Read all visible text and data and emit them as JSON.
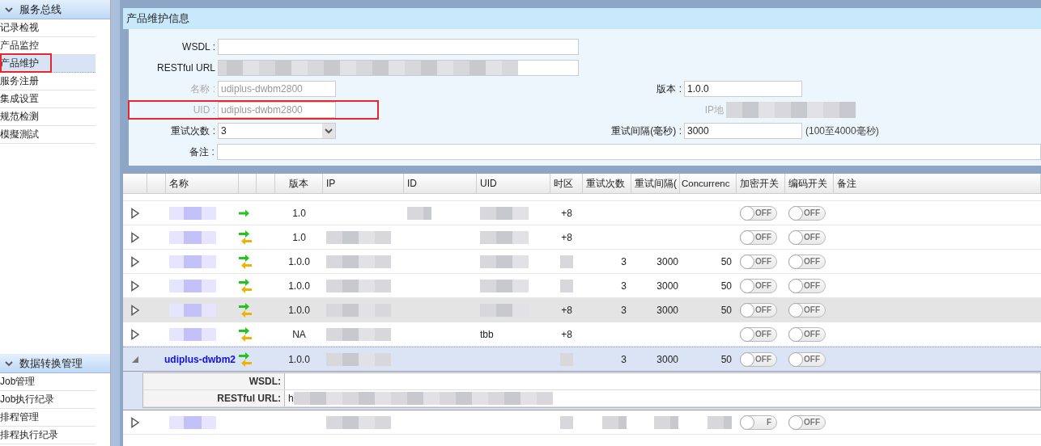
{
  "sidebar": {
    "sections": [
      {
        "title": "服务总线",
        "expanded": true,
        "items": [
          {
            "label": "记录检视",
            "selected": false,
            "marked": false
          },
          {
            "label": "产品监控",
            "selected": false,
            "marked": false
          },
          {
            "label": "产品维护",
            "selected": true,
            "marked": true
          },
          {
            "label": "服务注册",
            "selected": false,
            "marked": false
          },
          {
            "label": "集成设置",
            "selected": false,
            "marked": false
          },
          {
            "label": "规范检测",
            "selected": false,
            "marked": false
          },
          {
            "label": "模擬測試",
            "selected": false,
            "marked": false
          }
        ]
      },
      {
        "title": "数据转换管理",
        "expanded": true,
        "items": [
          {
            "label": "Job管理",
            "selected": false,
            "marked": false
          },
          {
            "label": "Job执行纪录",
            "selected": false,
            "marked": false
          },
          {
            "label": "排程管理",
            "selected": false,
            "marked": false
          },
          {
            "label": "排程执行纪录",
            "selected": false,
            "marked": false
          }
        ]
      }
    ]
  },
  "panel": {
    "title": "产品维护信息"
  },
  "form": {
    "wsdl": {
      "label": "WSDL :"
    },
    "url": {
      "label": "RESTful URL"
    },
    "name": {
      "label": "名称 :",
      "value": "udiplus-dwbm2800",
      "disabled": true,
      "marked": false
    },
    "uid": {
      "label": "UID :",
      "value": "udiplus-dwbm2800",
      "disabled": true,
      "marked": true
    },
    "retries": {
      "label": "重试次数 :",
      "value": "3"
    },
    "note": {
      "label": "备注 :"
    },
    "version": {
      "label": "版本 :",
      "value": "1.0.0"
    },
    "ip": {
      "label": "IP地",
      "disabled": true
    },
    "interval": {
      "label": "重试间隔(毫秒) :",
      "value": "3000",
      "hint": "(100至4000毫秒)"
    }
  },
  "table": {
    "columns": [
      "名称",
      "版本",
      "IP",
      "ID",
      "UID",
      "时区",
      "重试次数",
      "重试间隔(",
      "Concurrenc",
      "加密开关",
      "编码开关",
      "备注"
    ],
    "rows": [
      {
        "blurred": {
          "name": true,
          "id": true,
          "uid": true
        },
        "arrow": true,
        "return_arrow": false,
        "version": "1.0",
        "tz": "+8",
        "toggles": [
          {
            "label": "OFF",
            "on": false
          },
          {
            "label": "OFF",
            "on": false
          }
        ],
        "expanded": false,
        "selected": false,
        "hovered": false
      },
      {
        "blurred": {
          "name": true,
          "ip": true,
          "uid": true
        },
        "arrow": true,
        "return_arrow": true,
        "version": "1.0",
        "tz": "+8",
        "toggles": [
          {
            "label": "OFF",
            "on": false
          },
          {
            "label": "OFF",
            "on": false
          }
        ],
        "expanded": false,
        "selected": false,
        "hovered": false
      },
      {
        "blurred": {
          "name": true,
          "ip": true,
          "uid": true,
          "tz": true
        },
        "arrow": true,
        "return_arrow": true,
        "version": "1.0.0",
        "retries": "3",
        "interval": "3000",
        "concurrency": "50",
        "toggles": [
          {
            "label": "OFF",
            "on": false
          },
          {
            "label": "OFF",
            "on": false
          }
        ],
        "expanded": false,
        "selected": false,
        "hovered": false
      },
      {
        "blurred": {
          "name": true,
          "ip": true,
          "uid": true,
          "tz": true
        },
        "arrow": true,
        "return_arrow": true,
        "version": "1.0.0",
        "retries": "3",
        "interval": "3000",
        "concurrency": "50",
        "toggles": [
          {
            "label": "OFF",
            "on": false
          },
          {
            "label": "OFF",
            "on": false
          }
        ],
        "expanded": false,
        "selected": false,
        "hovered": false
      },
      {
        "blurred": {
          "name": true,
          "ip": true,
          "uid": true
        },
        "arrow": true,
        "return_arrow": true,
        "version": "1.0.0",
        "tz": "+8",
        "retries": "3",
        "interval": "3000",
        "concurrency": "50",
        "toggles": [
          {
            "label": "OFF",
            "on": false
          },
          {
            "label": "OFF",
            "on": false
          }
        ],
        "expanded": false,
        "selected": false,
        "hovered": true
      },
      {
        "blurred": {
          "name": true,
          "ip": true
        },
        "arrow": true,
        "return_arrow": true,
        "version": "NA",
        "uid": "tbb",
        "tz": "+8",
        "toggles": [
          {
            "label": "OFF",
            "on": false
          },
          {
            "label": "OFF",
            "on": false
          }
        ],
        "expanded": false,
        "selected": false,
        "hovered": false
      },
      {
        "name": "udiplus-dwbm2",
        "blurred": {
          "ip": true,
          "tz": true
        },
        "arrow": true,
        "return_arrow": true,
        "version": "1.0.0",
        "retries": "3",
        "interval": "3000",
        "concurrency": "50",
        "toggles": [
          {
            "label": "OFF",
            "on": false
          },
          {
            "label": "OFF",
            "on": false
          }
        ],
        "expanded": true,
        "selected": true,
        "hovered": false,
        "detail": {
          "wsdl_label": "WSDL:",
          "url_label": "RESTful URL:",
          "url_value": "h"
        }
      },
      {
        "blurred": {
          "name": true,
          "ip": true,
          "tz": true,
          "retries": true,
          "interval": true,
          "concurrency": true
        },
        "arrow": false,
        "toggles": [
          {
            "label": "F",
            "on": false
          },
          {
            "label": "OFF",
            "on": false
          }
        ],
        "expanded": false,
        "selected": false,
        "hovered": false
      }
    ]
  }
}
